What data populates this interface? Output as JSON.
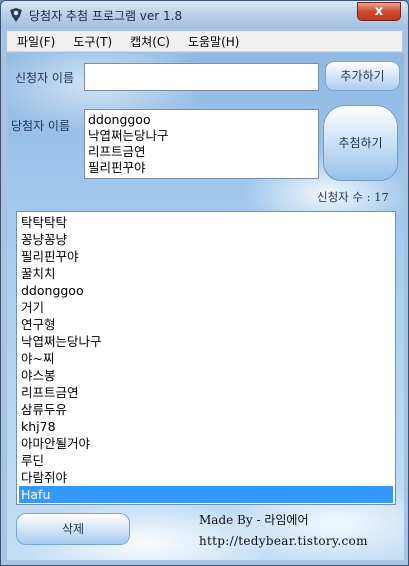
{
  "window": {
    "title": "당첨자 추첨 프로그램 ver 1.8",
    "close_label": "x"
  },
  "menu": {
    "items": [
      "파일(F)",
      "도구(T)",
      "캡쳐(C)",
      "도움말(H)"
    ]
  },
  "applicant": {
    "label": "신청자 이름",
    "input_value": "",
    "add_button": "추가하기"
  },
  "winner": {
    "label": "당첨자 이름",
    "names": [
      "ddonggoo",
      "낙엽쩌는당나구",
      "리프트금연",
      "필리핀꾸야"
    ],
    "draw_button": "추첨하기"
  },
  "count": {
    "text": "신청자 수 : 17"
  },
  "list": {
    "items": [
      "탁탁탁탁",
      "꽁냥꽁냥",
      "필리핀꾸야",
      "꿀치치",
      "ddonggoo",
      "거기",
      "연구형",
      "낙엽쩌는당나구",
      "야~찌",
      "야스봉",
      "리프트금연",
      "삼류두유",
      "khj78",
      "아마안될거야",
      "루딘",
      "다람쥐야",
      "Hafu"
    ],
    "selected_index": 16
  },
  "footer": {
    "delete_button": "삭제",
    "credit": "Made By - 라임에어",
    "url": "http://tedybear.tistory.com"
  },
  "colors": {
    "selection": "#3399ff",
    "close_button": "#cf4b30"
  }
}
